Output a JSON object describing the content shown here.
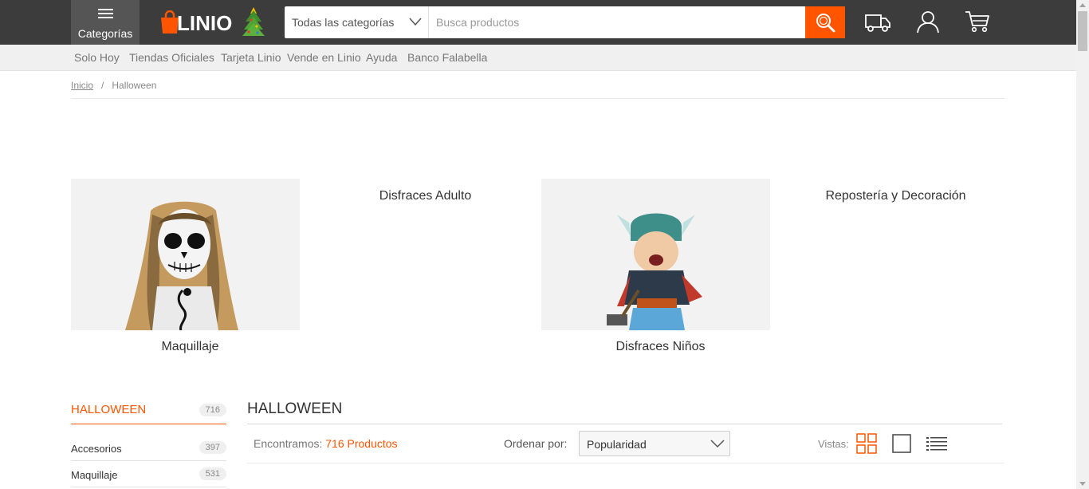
{
  "header": {
    "menu_label": "Categorías",
    "logo_text": "LINIO",
    "search": {
      "category_label": "Todas las categorías",
      "placeholder": "Busca productos"
    }
  },
  "subnav": {
    "items": [
      "Solo Hoy",
      "Tiendas Oficiales",
      "Tarjeta Linio",
      "Vende en Linio",
      "Ayuda",
      "Banco Falabella"
    ]
  },
  "breadcrumb": {
    "home": "Inicio",
    "separator": "/",
    "current": "Halloween"
  },
  "categories": [
    {
      "label": "Maquillaje"
    },
    {
      "label": "Disfraces Adulto"
    },
    {
      "label": "Disfraces Niños"
    },
    {
      "label": "Repostería y Decoración"
    }
  ],
  "sidebar": {
    "title": "HALLOWEEN",
    "count": "716",
    "items": [
      {
        "label": "Accesorios",
        "count": "397"
      },
      {
        "label": "Maquillaje",
        "count": "531"
      }
    ]
  },
  "results": {
    "title": "HALLOWEEN",
    "found_prefix": "Encontramos:",
    "found_count": "716 Productos",
    "sort_label": "Ordenar por:",
    "sort_value": "Popularidad",
    "views_label": "Vistas:"
  },
  "colors": {
    "accent": "#ff5500",
    "topbar": "#3c3c3c",
    "subnav": "#f0f0f0"
  }
}
